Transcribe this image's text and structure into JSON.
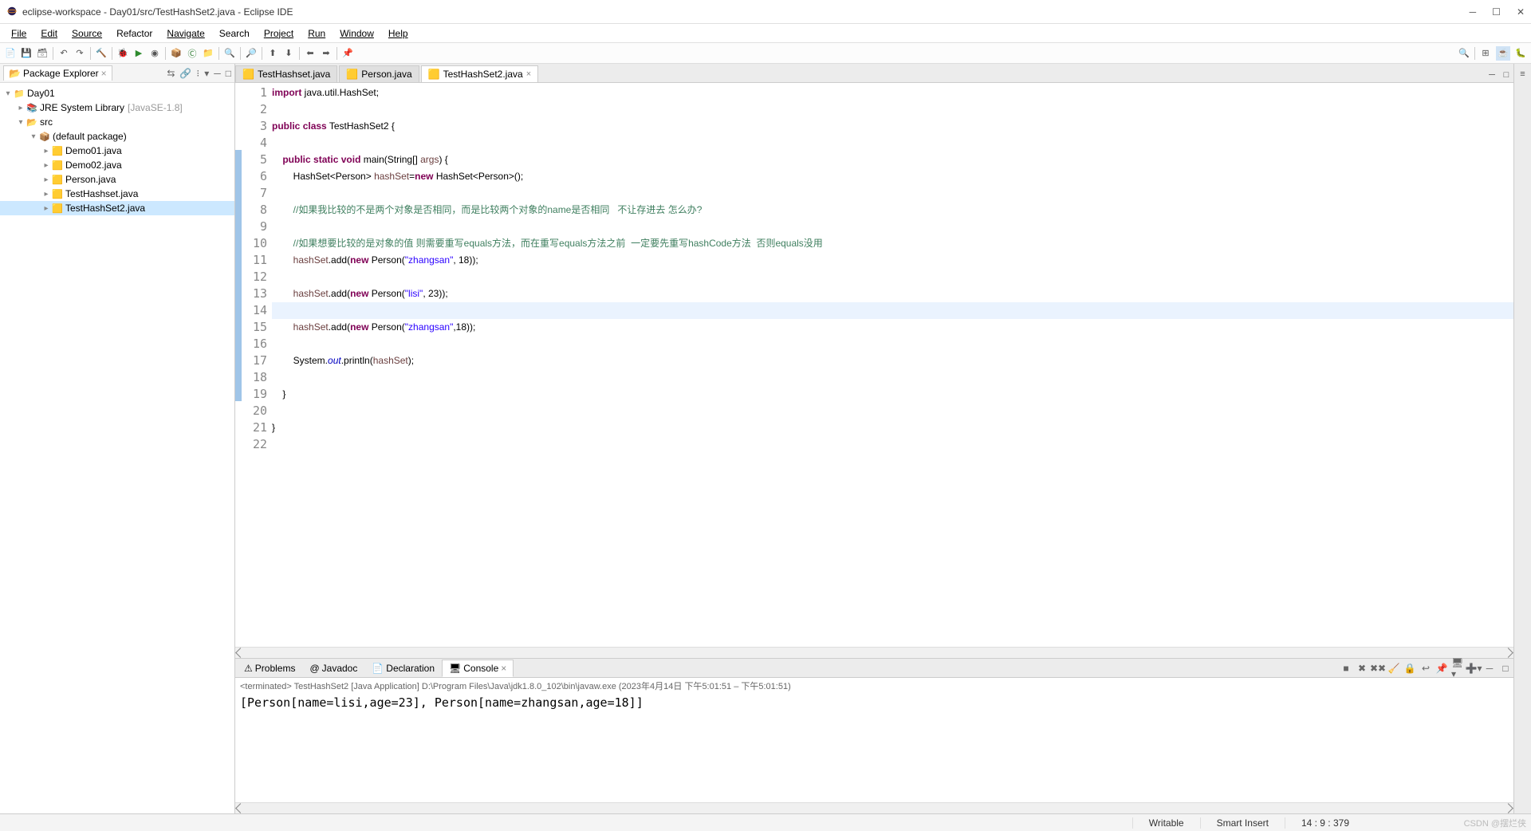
{
  "window": {
    "title": "eclipse-workspace - Day01/src/TestHashSet2.java - Eclipse IDE"
  },
  "menu": {
    "file": "File",
    "edit": "Edit",
    "source": "Source",
    "refactor": "Refactor",
    "navigate": "Navigate",
    "search": "Search",
    "project": "Project",
    "run": "Run",
    "window": "Window",
    "help": "Help"
  },
  "package_explorer": {
    "title": "Package Explorer",
    "project": "Day01",
    "jre": "JRE System Library",
    "jre_tail": "[JavaSE-1.8]",
    "src": "src",
    "default_pkg": "(default package)",
    "files": {
      "f0": "Demo01.java",
      "f1": "Demo02.java",
      "f2": "Person.java",
      "f3": "TestHashset.java",
      "f4": "TestHashSet2.java"
    }
  },
  "editor_tabs": {
    "t0": "TestHashset.java",
    "t1": "Person.java",
    "t2": "TestHashSet2.java"
  },
  "code": {
    "lines": {
      "1": "1",
      "2": "2",
      "3": "3",
      "4": "4",
      "5": "5",
      "6": "6",
      "7": "7",
      "8": "8",
      "9": "9",
      "10": "10",
      "11": "11",
      "12": "12",
      "13": "13",
      "14": "14",
      "15": "15",
      "16": "16",
      "17": "17",
      "18": "18",
      "19": "19",
      "20": "20",
      "21": "21",
      "22": "22"
    },
    "l1_kw": "import",
    "l1_rest": " java.util.HashSet;",
    "l3_kw1": "public",
    "l3_kw2": "class",
    "l3_name": "TestHashSet2",
    "l3_brace": " {",
    "l5_kw1": "public",
    "l5_kw2": "static",
    "l5_kw3": "void",
    "l5_name": "main",
    "l5_sig": "(String[] ",
    "l5_arg": "args",
    "l5_close": ") {",
    "l6_a": "        HashSet<Person> ",
    "l6_var": "hashSet",
    "l6_b": "=",
    "l6_kw": "new",
    "l6_c": " HashSet<Person>();",
    "l8_com": "        //如果我比较的不是两个对象是否相同，而是比较两个对象的name是否相同   不让存进去 怎么办?",
    "l10_com": "        //如果想要比较的是对象的值 则需要重写equals方法，而在重写equals方法之前  一定要先重写hashCode方法  否则equals没用",
    "l11_a": "        ",
    "l11_var": "hashSet",
    "l11_b": ".add(",
    "l11_kw": "new",
    "l11_c": " Person(",
    "l11_str": "\"zhangsan\"",
    "l11_d": ", 18));",
    "l13_a": "        ",
    "l13_var": "hashSet",
    "l13_b": ".add(",
    "l13_kw": "new",
    "l13_c": " Person(",
    "l13_str": "\"lisi\"",
    "l13_d": ", 23));",
    "l15_a": "        ",
    "l15_var": "hashSet",
    "l15_b": ".add(",
    "l15_kw": "new",
    "l15_c": " Person(",
    "l15_str": "\"zhangsan\"",
    "l15_d": ",18));",
    "l17_a": "        System.",
    "l17_out": "out",
    "l17_b": ".println(",
    "l17_var": "hashSet",
    "l17_c": ");",
    "l19": "    }",
    "l21": "}"
  },
  "bottom_tabs": {
    "problems": "Problems",
    "javadoc": "Javadoc",
    "declaration": "Declaration",
    "console": "Console"
  },
  "console": {
    "terminated": "<terminated> TestHashSet2 [Java Application] D:\\Program Files\\Java\\jdk1.8.0_102\\bin\\javaw.exe  (2023年4月14日 下午5:01:51 – 下午5:01:51)",
    "output": "[Person[name=lisi,age=23], Person[name=zhangsan,age=18]]"
  },
  "status": {
    "writable": "Writable",
    "insert": "Smart Insert",
    "pos": "14 : 9 : 379"
  },
  "watermark": "CSDN @摆烂侠"
}
